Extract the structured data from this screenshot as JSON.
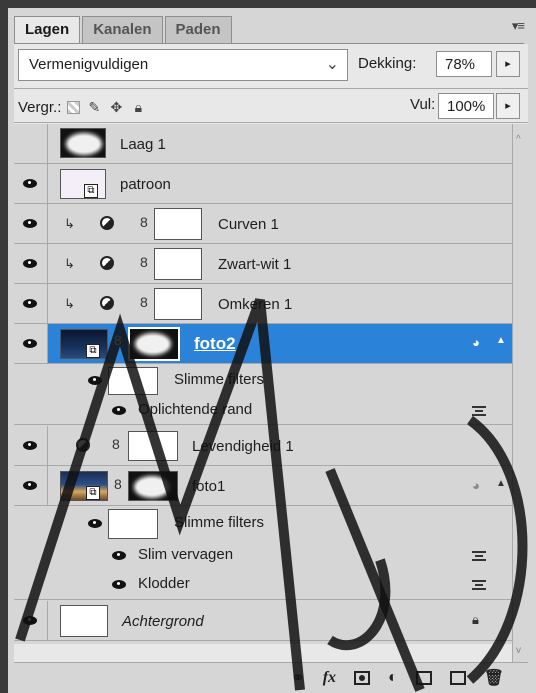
{
  "tabs": [
    {
      "label": "Lagen",
      "active": true
    },
    {
      "label": "Kanalen",
      "active": false
    },
    {
      "label": "Paden",
      "active": false
    }
  ],
  "panel_menu_icon": "panel-menu-icon",
  "blend_mode": {
    "value": "Vermenigvuldigen"
  },
  "opacity": {
    "label": "Dekking:",
    "value": "78%"
  },
  "lock": {
    "label": "Vergr.:"
  },
  "fill": {
    "label": "Vul:",
    "value": "100%"
  },
  "layers": [
    {
      "name": "Laag 1",
      "visible": false
    },
    {
      "name": "patroon",
      "visible": true
    },
    {
      "name": "Curven 1",
      "visible": true
    },
    {
      "name": "Zwart-wit 1",
      "visible": true
    },
    {
      "name": "Omkeren 1",
      "visible": true
    },
    {
      "name": "foto2",
      "visible": true,
      "selected": true
    },
    {
      "name": "Slimme filters"
    },
    {
      "name": "Oplichtende rand"
    },
    {
      "name": "Levendigheid 1",
      "visible": true
    },
    {
      "name": "foto1",
      "visible": true
    },
    {
      "name": "Slimme filters"
    },
    {
      "name": "Slim vervagen"
    },
    {
      "name": "Klodder"
    },
    {
      "name": "Achtergrond",
      "visible": true
    }
  ],
  "toolbar": [
    "link-icon",
    "fx-icon",
    "mask-icon",
    "adjustment-icon",
    "group-icon",
    "new-layer-icon",
    "trash-icon"
  ],
  "colors": {
    "selected": "#2b82d9",
    "panel": "#d6d6d6"
  }
}
